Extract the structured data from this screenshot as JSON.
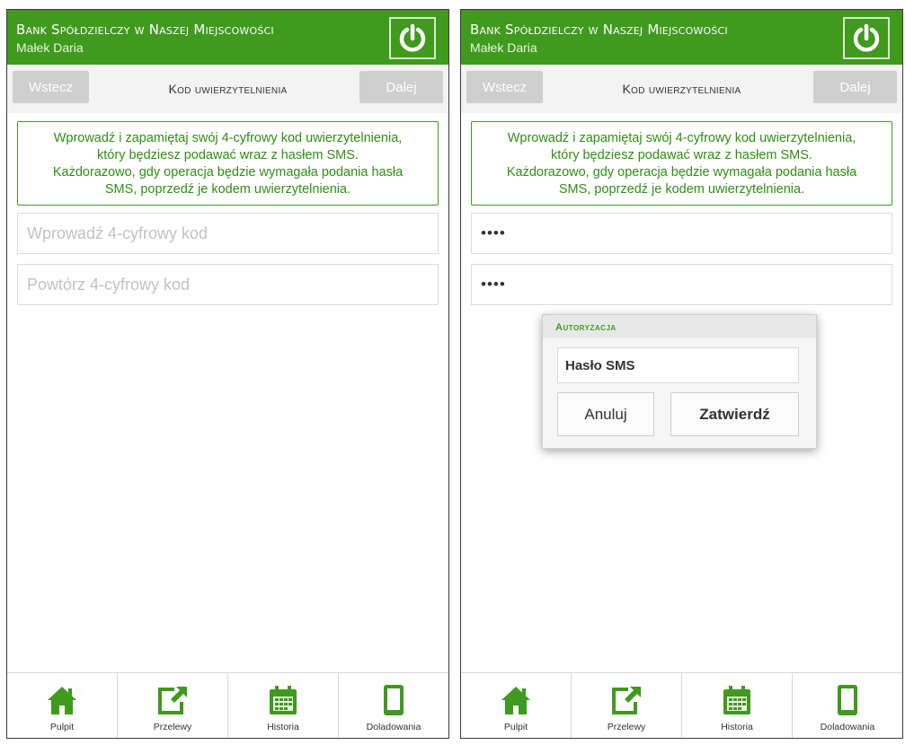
{
  "colors": {
    "brand_green": "#3f9a1e",
    "disabled_button": "#cfcfcf",
    "info_text": "#2f8f14"
  },
  "left": {
    "header": {
      "bank_name": "Bank Spółdzielczy w Naszej Miejscowości",
      "user_name": "Małek Daria",
      "power_icon": "power-icon"
    },
    "toolbar": {
      "back_label": "Wstecz",
      "title": "Kod uwierzytelnienia",
      "next_label": "Dalej"
    },
    "info": {
      "line1": "Wprowadź i zapamiętaj swój 4-cyfrowy kod uwierzytelnienia,",
      "line2": "który będziesz podawać wraz z hasłem SMS.",
      "line3": "Każdorazowo, gdy operacja będzie wymagała podania hasła",
      "line4": "SMS, poprzedź je kodem uwierzytelnienia."
    },
    "code_field": {
      "placeholder": "Wprowadź 4-cyfrowy kod",
      "value": ""
    },
    "repeat_field": {
      "placeholder": "Powtórz 4-cyfrowy kod",
      "value": ""
    },
    "tabs": [
      {
        "label": "Pulpit",
        "icon": "home-icon"
      },
      {
        "label": "Przelewy",
        "icon": "transfer-icon"
      },
      {
        "label": "Historia",
        "icon": "calendar-icon"
      },
      {
        "label": "Doladowania",
        "icon": "phone-icon"
      }
    ]
  },
  "right": {
    "header": {
      "bank_name": "Bank Spółdzielczy w Naszej Miejscowości",
      "user_name": "Małek Daria",
      "power_icon": "power-icon"
    },
    "toolbar": {
      "back_label": "Wstecz",
      "title": "Kod uwierzytelnienia",
      "next_label": "Dalej"
    },
    "info": {
      "line1": "Wprowadź i zapamiętaj swój 4-cyfrowy kod uwierzytelnienia,",
      "line2": "który będziesz podawać wraz z hasłem SMS.",
      "line3": "Każdorazowo, gdy operacja będzie wymagała podania hasła",
      "line4": "SMS, poprzedź je kodem uwierzytelnienia."
    },
    "code_field": {
      "value": "••••"
    },
    "repeat_field": {
      "value": "••••"
    },
    "dialog": {
      "title": "Autoryzacja",
      "sms_placeholder": "Hasło SMS",
      "cancel_label": "Anuluj",
      "confirm_label": "Zatwierdź"
    },
    "tabs": [
      {
        "label": "Pulpit",
        "icon": "home-icon"
      },
      {
        "label": "Przelewy",
        "icon": "transfer-icon"
      },
      {
        "label": "Historia",
        "icon": "calendar-icon"
      },
      {
        "label": "Doladowania",
        "icon": "phone-icon"
      }
    ]
  }
}
